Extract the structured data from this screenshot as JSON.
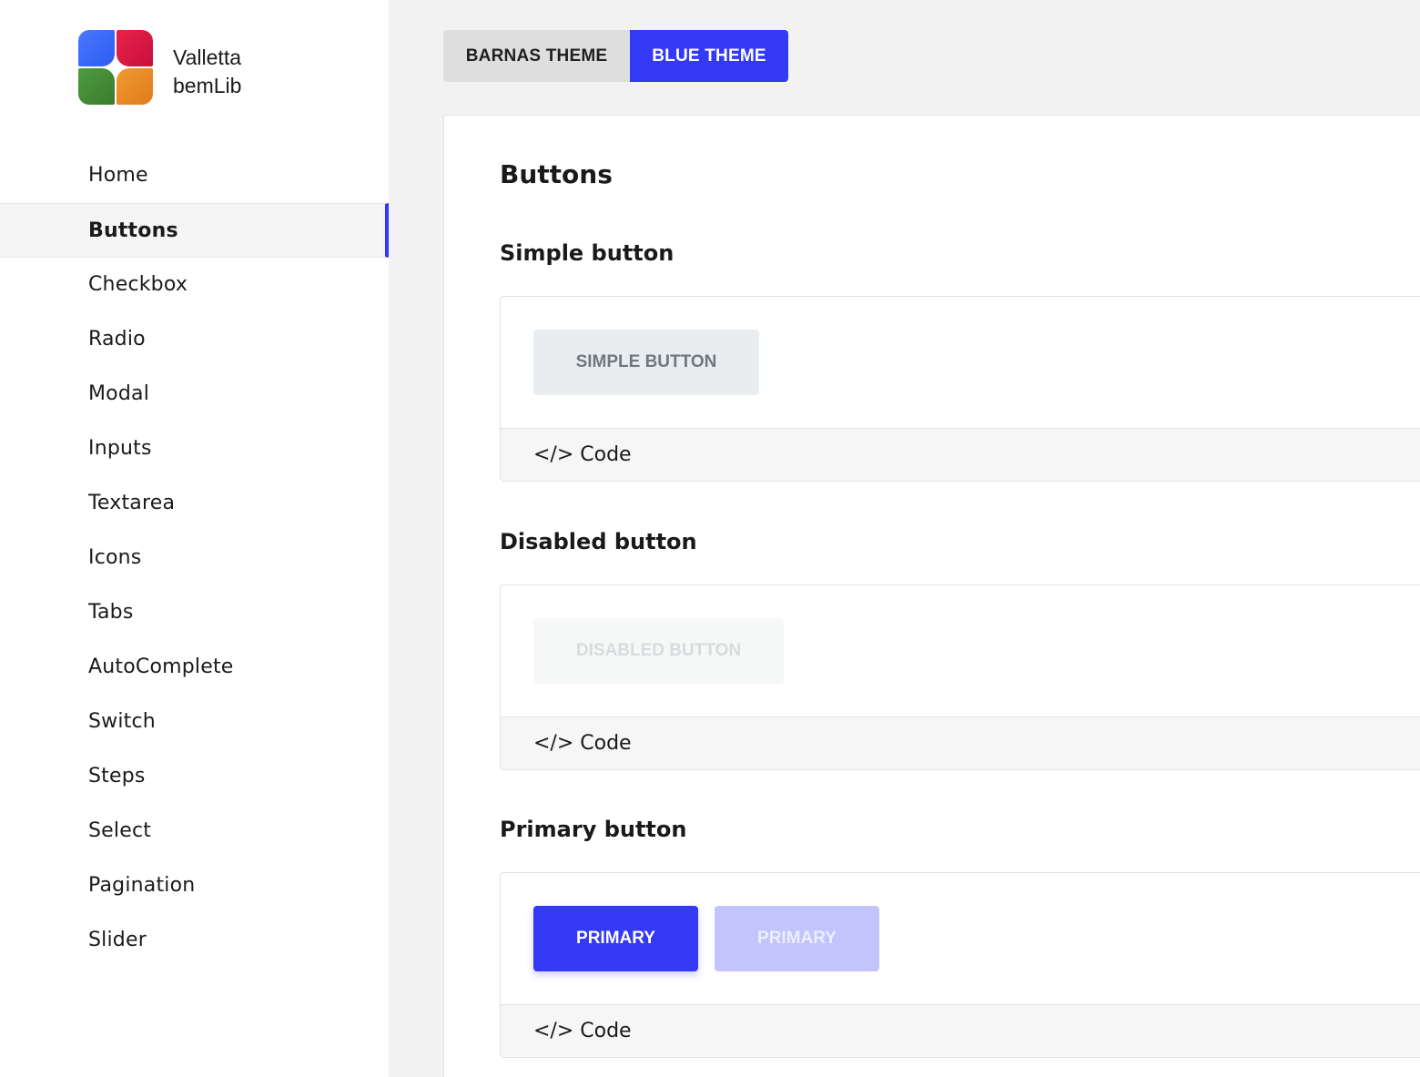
{
  "brand": {
    "line1": "Valletta",
    "line2": "bemLib",
    "logo_icon": "valletta-logo-icon"
  },
  "sidebar": {
    "items": [
      {
        "label": "Home"
      },
      {
        "label": "Buttons",
        "active": true
      },
      {
        "label": "Checkbox"
      },
      {
        "label": "Radio"
      },
      {
        "label": "Modal"
      },
      {
        "label": "Inputs"
      },
      {
        "label": "Textarea"
      },
      {
        "label": "Icons"
      },
      {
        "label": "Tabs"
      },
      {
        "label": "AutoComplete"
      },
      {
        "label": "Switch"
      },
      {
        "label": "Steps"
      },
      {
        "label": "Select"
      },
      {
        "label": "Pagination"
      },
      {
        "label": "Slider"
      }
    ]
  },
  "themes": {
    "barnas_label": "BARNAS THEME",
    "blue_label": "BLUE THEME",
    "active": "BLUE THEME"
  },
  "main": {
    "title": "Buttons",
    "sections": [
      {
        "title": "Simple button",
        "buttons": [
          "SIMPLE BUTTON"
        ],
        "code_label": "</> Code"
      },
      {
        "title": "Disabled button",
        "buttons": [
          "DISABLED BUTTON"
        ],
        "code_label": "</> Code"
      },
      {
        "title": "Primary button",
        "buttons": [
          "PRIMARY",
          "PRIMARY"
        ],
        "code_label": "</> Code"
      }
    ]
  },
  "colors": {
    "accent": "#3339f5",
    "sidebar_bg": "#ffffff",
    "page_bg": "#f2f2f2"
  }
}
